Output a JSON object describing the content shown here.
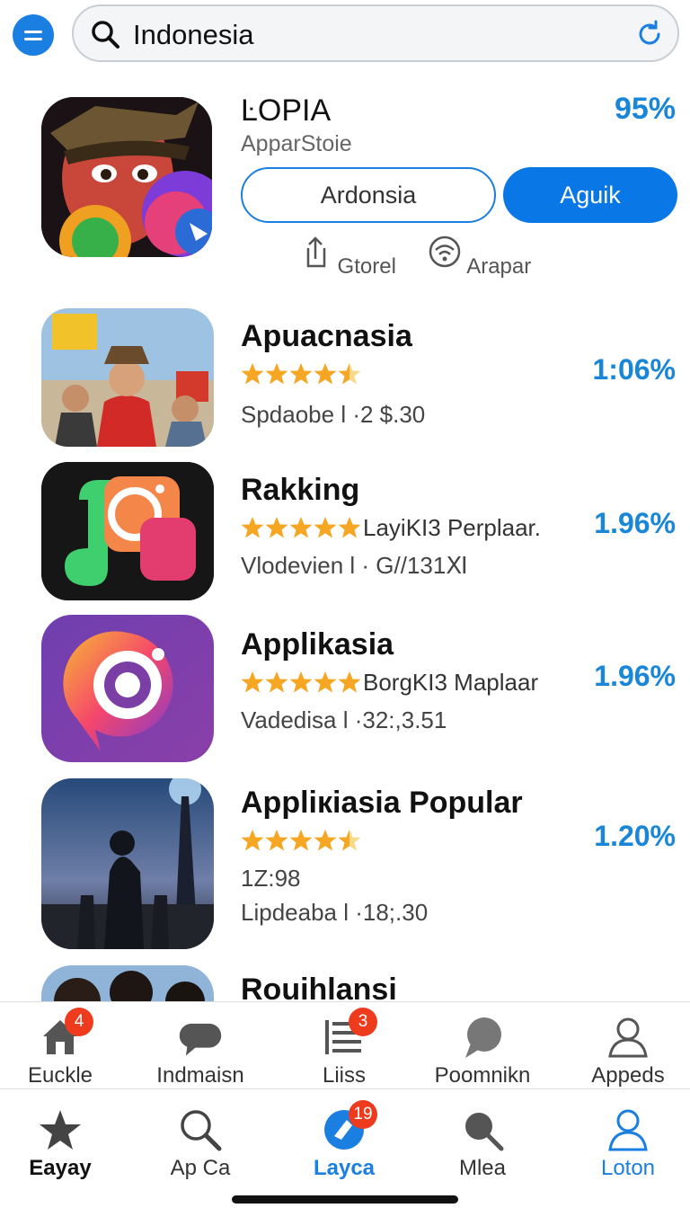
{
  "search": {
    "query": "Indonesia"
  },
  "featured": {
    "title": "ĿOPIA",
    "subtitle": "ApparStoie",
    "percent": "95%",
    "button_secondary": "Ardonsia",
    "button_primary": "Aguik",
    "actions": [
      {
        "label": "Gtorel",
        "icon": "share-icon"
      },
      {
        "label": "Arapar",
        "icon": "wifi-icon"
      }
    ]
  },
  "apps": [
    {
      "title": "Apuacnasia",
      "stars": 4.5,
      "rank_text": "",
      "line": "Spdaobe l ·2 $.30",
      "percent": "1:06%"
    },
    {
      "title": "Rakking",
      "stars": 5,
      "rank_text": "LayiKI3 Perplaar.",
      "line": "Vlodevien l · G//131Ⅺ",
      "percent": "1.96%"
    },
    {
      "title": "Applikasia",
      "stars": 5,
      "rank_text": "BorgKI3 Maplaar",
      "line": "Vadedisa l ·32:,3.51",
      "percent": "1.96%"
    },
    {
      "title": "Appliкiasia Popular",
      "stars": 4.5,
      "rank_text": "",
      "extra": "1Z:98",
      "line": "Lipdeaba l ·18;.30",
      "percent": "1.20%"
    },
    {
      "title": "Rouihlansi"
    }
  ],
  "subnav": [
    {
      "label": "Euckle",
      "icon": "home-icon",
      "badge": "4"
    },
    {
      "label": "Indmaisn",
      "icon": "chat-bubble-icon",
      "badge": ""
    },
    {
      "label": "Liiss",
      "icon": "list-icon",
      "badge": "3"
    },
    {
      "label": "Poomnikn",
      "icon": "comment-icon",
      "badge": ""
    },
    {
      "label": "Appeds",
      "icon": "person-icon",
      "badge": ""
    }
  ],
  "tabs": [
    {
      "label": "Eayay",
      "icon": "star-icon",
      "badge": ""
    },
    {
      "label": "Ap Ca",
      "icon": "search-icon",
      "badge": ""
    },
    {
      "label": "Layca",
      "icon": "apps-icon",
      "badge": "19"
    },
    {
      "label": "Mlea",
      "icon": "search-icon",
      "badge": ""
    },
    {
      "label": "Loton",
      "icon": "person-icon",
      "badge": ""
    }
  ],
  "colors": {
    "accent": "#1a7fe0",
    "percent": "#1a86d8",
    "star": "#f5a623",
    "badge": "#ee3b1d"
  }
}
